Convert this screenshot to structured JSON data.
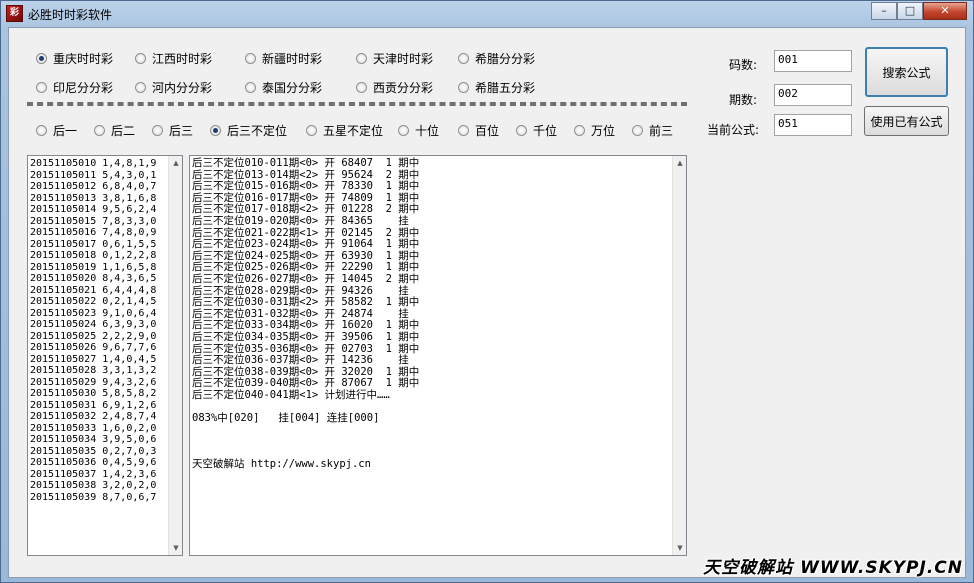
{
  "window": {
    "title": "必胜时时彩软件",
    "icon": "lottery-app-icon",
    "controls": {
      "minimize": "–",
      "maximize": "□",
      "close": "✕"
    }
  },
  "lotteries": [
    {
      "label": "重庆时时彩",
      "checked": true
    },
    {
      "label": "江西时时彩",
      "checked": false
    },
    {
      "label": "新疆时时彩",
      "checked": false
    },
    {
      "label": "天津时时彩",
      "checked": false
    },
    {
      "label": "希腊分分彩",
      "checked": false
    },
    {
      "label": "印尼分分彩",
      "checked": false
    },
    {
      "label": "河内分分彩",
      "checked": false
    },
    {
      "label": "泰国分分彩",
      "checked": false
    },
    {
      "label": "西贡分分彩",
      "checked": false
    },
    {
      "label": "希腊五分彩",
      "checked": false
    }
  ],
  "positions": [
    {
      "label": "后一",
      "checked": false
    },
    {
      "label": "后二",
      "checked": false
    },
    {
      "label": "后三",
      "checked": false
    },
    {
      "label": "后三不定位",
      "checked": true
    },
    {
      "label": "五星不定位",
      "checked": false
    },
    {
      "label": "十位",
      "checked": false
    },
    {
      "label": "百位",
      "checked": false
    },
    {
      "label": "千位",
      "checked": false
    },
    {
      "label": "万位",
      "checked": false
    },
    {
      "label": "前三",
      "checked": false
    }
  ],
  "fields": {
    "code_count": {
      "label": "码数:",
      "value": "001"
    },
    "period_count": {
      "label": "期数:",
      "value": "002"
    },
    "current_formula": {
      "label": "当前公式:",
      "value": "051"
    }
  },
  "buttons": {
    "search_formula": "搜索公式",
    "use_existing_formula": "使用已有公式"
  },
  "draw_history": [
    "20151105010 1,4,8,1,9",
    "20151105011 5,4,3,0,1",
    "20151105012 6,8,4,0,7",
    "20151105013 3,8,1,6,8",
    "20151105014 9,5,6,2,4",
    "20151105015 7,8,3,3,0",
    "20151105016 7,4,8,0,9",
    "20151105017 0,6,1,5,5",
    "20151105018 0,1,2,2,8",
    "20151105019 1,1,6,5,8",
    "20151105020 8,4,3,6,5",
    "20151105021 6,4,4,4,8",
    "20151105022 0,2,1,4,5",
    "20151105023 9,1,0,6,4",
    "20151105024 6,3,9,3,0",
    "20151105025 2,2,2,9,0",
    "20151105026 9,6,7,7,6",
    "20151105027 1,4,0,4,5",
    "20151105028 3,3,1,3,2",
    "20151105029 9,4,3,2,6",
    "20151105030 5,8,5,8,2",
    "20151105031 6,9,1,2,6",
    "20151105032 2,4,8,7,4",
    "20151105033 1,6,0,2,0",
    "20151105034 3,9,5,0,6",
    "20151105035 0,2,7,0,3",
    "20151105036 0,4,5,9,6",
    "20151105037 1,4,2,3,6",
    "20151105038 3,2,0,2,0",
    "20151105039 8,7,0,6,7"
  ],
  "result_log": [
    "后三不定位010-011期<0> 开 68407  1 期中",
    "后三不定位013-014期<2> 开 95624  2 期中",
    "后三不定位015-016期<0> 开 78330  1 期中",
    "后三不定位016-017期<0> 开 74809  1 期中",
    "后三不定位017-018期<2> 开 01228  2 期中",
    "后三不定位019-020期<0> 开 84365    挂",
    "后三不定位021-022期<1> 开 02145  2 期中",
    "后三不定位023-024期<0> 开 91064  1 期中",
    "后三不定位024-025期<0> 开 63930  1 期中",
    "后三不定位025-026期<0> 开 22290  1 期中",
    "后三不定位026-027期<0> 开 14045  2 期中",
    "后三不定位028-029期<0> 开 94326    挂",
    "后三不定位030-031期<2> 开 58582  1 期中",
    "后三不定位031-032期<0> 开 24874    挂",
    "后三不定位033-034期<0> 开 16020  1 期中",
    "后三不定位034-035期<0> 开 39506  1 期中",
    "后三不定位035-036期<0> 开 02703  1 期中",
    "后三不定位036-037期<0> 开 14236    挂",
    "后三不定位038-039期<0> 开 32020  1 期中",
    "后三不定位039-040期<0> 开 87067  1 期中",
    "后三不定位040-041期<1> 计划进行中……",
    "",
    "083%中[020]   挂[004] 连挂[000]",
    "",
    "",
    "",
    "天空破解站 http://www.skypj.cn"
  ],
  "watermark": "天空破解站 WWW.SKYPJ.CN"
}
